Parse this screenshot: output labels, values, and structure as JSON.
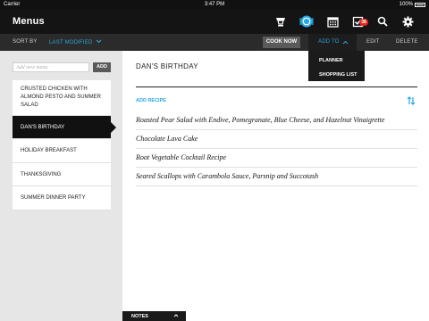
{
  "status_bar": {
    "carrier": "Carrier",
    "time": "3:47 PM",
    "battery": "100%"
  },
  "nav": {
    "title": "Menus",
    "badge_count": "38"
  },
  "toolbar": {
    "sort_by": "SORT BY",
    "sort_value": "LAST MODIFIED",
    "cook_now": "COOK NOW",
    "add_to": "ADD TO",
    "edit": "EDIT",
    "delete": "DELETE"
  },
  "add_to_menu": {
    "items": [
      "PLANNER",
      "SHOPPING LIST"
    ]
  },
  "sidebar": {
    "input_placeholder": "Add new menu",
    "add_button": "ADD",
    "menus": [
      "CRUSTED CHICKEN WITH ALMOND PESTO AND SUMMER SALAD",
      "DAN'S BIRTHDAY",
      "HOLIDAY BREAKFAST",
      "THANKSGIVING",
      "SUMMER DINNER PARTY"
    ],
    "selected_index": 1
  },
  "main": {
    "title": "DAN'S BIRTHDAY",
    "add_recipe": "ADD RECIPE",
    "recipes": [
      "Roasted Pear Salad with Endive, Pomegranate, Blue Cheese, and Hazelnut Vinaigrette",
      "Chocolate Lava Cake",
      "Root Vegetable Cocktail Recipe",
      "Seared Scallops with Carambola Sauce, Parsnip and Succotash"
    ]
  },
  "notes": {
    "label": "NOTES"
  },
  "colors": {
    "accent": "#29a8e0",
    "badge": "#e8251d",
    "dark": "#141414"
  },
  "icons": [
    "mixer-icon",
    "plate-icon",
    "calendar-icon",
    "checklist-icon",
    "search-icon",
    "gear-icon",
    "chevron-down-icon",
    "chevron-up-icon",
    "sort-icon"
  ]
}
